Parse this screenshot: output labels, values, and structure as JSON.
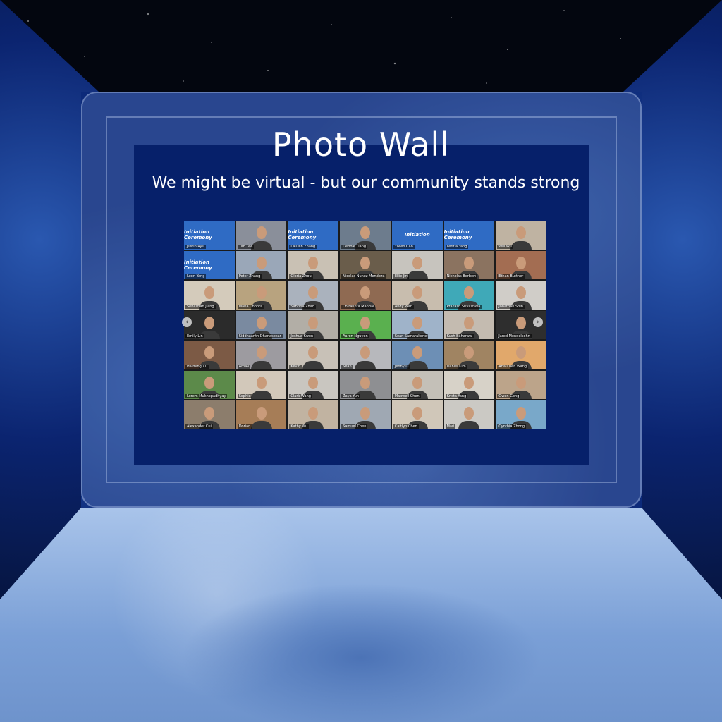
{
  "page": {
    "title": "Photo Wall",
    "subtitle": "We might be virtual - but our community stands strong"
  },
  "colors": {
    "back_wall": "#0c2a7a",
    "inner_panel": "#06206a",
    "floor": "#a9c4ea",
    "title_text": "#ffffff"
  },
  "icons": {
    "prev": "chevron-left-icon",
    "next": "chevron-right-icon"
  },
  "grid": {
    "tiles": [
      {
        "name": "Justin Ryu",
        "slide": true,
        "slide_text": "Initiation Ceremony",
        "bg": "#2f6bc4"
      },
      {
        "name": "Tim Lee",
        "bg": "#8a8f9a"
      },
      {
        "name": "Lauren Zhang",
        "slide": true,
        "slide_text": "Initiation Ceremony",
        "bg": "#2f6bc4"
      },
      {
        "name": "Debbie Liang",
        "bg": "#6d7c8d"
      },
      {
        "name": "Yiwen Cao",
        "slide": true,
        "slide_text": "Initiation",
        "bg": "#2f6bc4"
      },
      {
        "name": "Letitia Yang",
        "slide": true,
        "slide_text": "Initiation Ceremony",
        "bg": "#2f6bc4"
      },
      {
        "name": "Will Wu",
        "bg": "#bfb3a2"
      },
      {
        "name": "Leon Yang",
        "slide": true,
        "slide_text": "Initiation Ceremony",
        "bg": "#2f6bc4"
      },
      {
        "name": "Peter Zhang",
        "bg": "#9aa7b8"
      },
      {
        "name": "Gloria Zhou",
        "bg": "#c9c1b4"
      },
      {
        "name": "Nicolas Nunez Mendoza",
        "bg": "#6a5d4b"
      },
      {
        "name": "Ellie Jin",
        "bg": "#c7c4be"
      },
      {
        "name": "Nicholas Berbert",
        "bg": "#8b7360"
      },
      {
        "name": "Ethan Buttner",
        "bg": "#a36d52"
      },
      {
        "name": "Sebastian Jiang",
        "bg": "#d4cbbb"
      },
      {
        "name": "Maria Chopra",
        "bg": "#b8a37f"
      },
      {
        "name": "Sabrina Zhao",
        "bg": "#aab2bd"
      },
      {
        "name": "Chiraunta Mandal",
        "bg": "#8f6a52"
      },
      {
        "name": "Andy Wan",
        "bg": "#c8bdae"
      },
      {
        "name": "Prakash Srivastava",
        "bg": "#3fa9b8"
      },
      {
        "name": "Jonathan Shih",
        "bg": "#d0cdc8"
      },
      {
        "name": "Emily Lin",
        "bg": "#2b2b2b"
      },
      {
        "name": "Siddhaanth Dhanasekar",
        "bg": "#7a8aa0"
      },
      {
        "name": "Joshua Kwon",
        "bg": "#b2aea6"
      },
      {
        "name": "Aaron Nguyen",
        "bg": "#5ab04f"
      },
      {
        "name": "Sean Samarakone",
        "bg": "#9fb3c9"
      },
      {
        "name": "Kush Baharwal",
        "bg": "#c4bbb0"
      },
      {
        "name": "Jared Mendelsohn",
        "bg": "#2e2e2e"
      },
      {
        "name": "Haiming Xu",
        "bg": "#7c5a45"
      },
      {
        "name": "Arnav",
        "bg": "#9d9ba0"
      },
      {
        "name": "Kevin",
        "bg": "#c8c1b7"
      },
      {
        "name": "Sean",
        "bg": "#b7b8bc"
      },
      {
        "name": "Jenny Li",
        "bg": "#6d8fb5"
      },
      {
        "name": "Daniel Kim",
        "bg": "#a08462"
      },
      {
        "name": "Ana Chen Wang",
        "bg": "#e1a86b"
      },
      {
        "name": "Lorem Mukhopadhyay",
        "bg": "#5c8a4a"
      },
      {
        "name": "Sophie",
        "bg": "#d2c8ba"
      },
      {
        "name": "Clark Wang",
        "bg": "#c9c6c0"
      },
      {
        "name": "Zaya Yun",
        "bg": "#8e8f92"
      },
      {
        "name": "Maxwell Chen",
        "bg": "#c4c0b8"
      },
      {
        "name": "Krista Yang",
        "bg": "#d7d2c8"
      },
      {
        "name": "Owen Gong",
        "bg": "#bca48a"
      },
      {
        "name": "Alexander Cui",
        "bg": "#8c7d6c"
      },
      {
        "name": "Dorian",
        "bg": "#a67d57"
      },
      {
        "name": "Kathy Wu",
        "bg": "#c1b3a1"
      },
      {
        "name": "Samuel Chen",
        "bg": "#9fa8b3"
      },
      {
        "name": "Caitlyn Chen",
        "bg": "#d0c7b9"
      },
      {
        "name": "Mari",
        "bg": "#cbc9c4"
      },
      {
        "name": "Cynthia Zhong",
        "bg": "#79a8c9"
      }
    ]
  }
}
